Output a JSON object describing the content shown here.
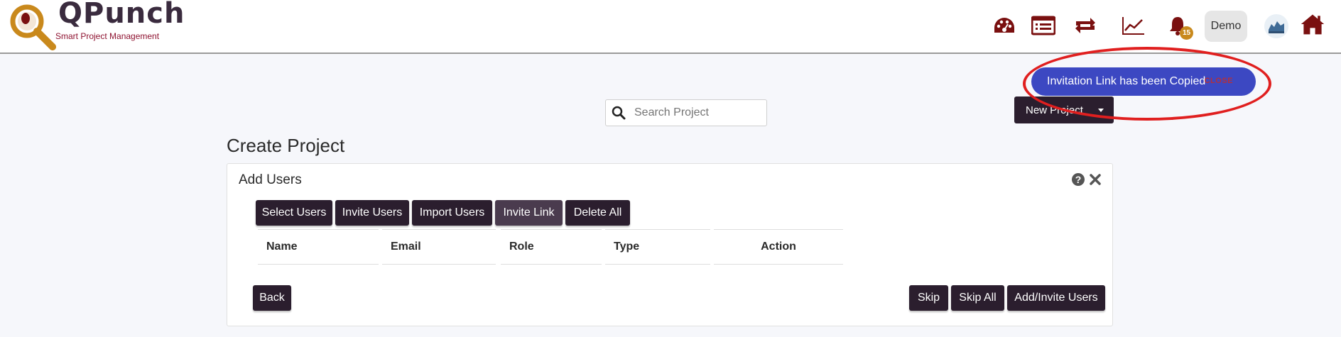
{
  "brand": {
    "name": "QPunch",
    "tagline": "Smart Project Management"
  },
  "nav": {
    "icons": [
      "dashboard-icon",
      "list-icon",
      "sync-icon",
      "chart-line-icon",
      "bell-icon",
      "home-icon"
    ],
    "notification_count": "15",
    "user_label": "Demo"
  },
  "toast": {
    "message": "Invitation Link has been Copied",
    "close_label": "CLOSE"
  },
  "search": {
    "placeholder": "Search Project"
  },
  "new_project": {
    "label": "New Project"
  },
  "page": {
    "title": "Create Project"
  },
  "panel": {
    "title": "Add Users",
    "tabs": [
      {
        "label": "Select Users"
      },
      {
        "label": "Invite Users"
      },
      {
        "label": "Import Users"
      },
      {
        "label": "Invite Link"
      },
      {
        "label": "Delete All"
      }
    ],
    "table_headers": [
      "Name",
      "Email",
      "Role",
      "Type",
      "Action"
    ],
    "footer": {
      "back_label": "Back",
      "skip_label": "Skip",
      "skip_all_label": "Skip All",
      "add_invite_label": "Add/Invite Users"
    }
  },
  "colors": {
    "brand_dark": "#2b1e2e",
    "icon_red": "#7a1010",
    "toast_blue": "#3c48c2",
    "highlight_red": "#e01f1f",
    "badge_gold": "#c9891c"
  }
}
